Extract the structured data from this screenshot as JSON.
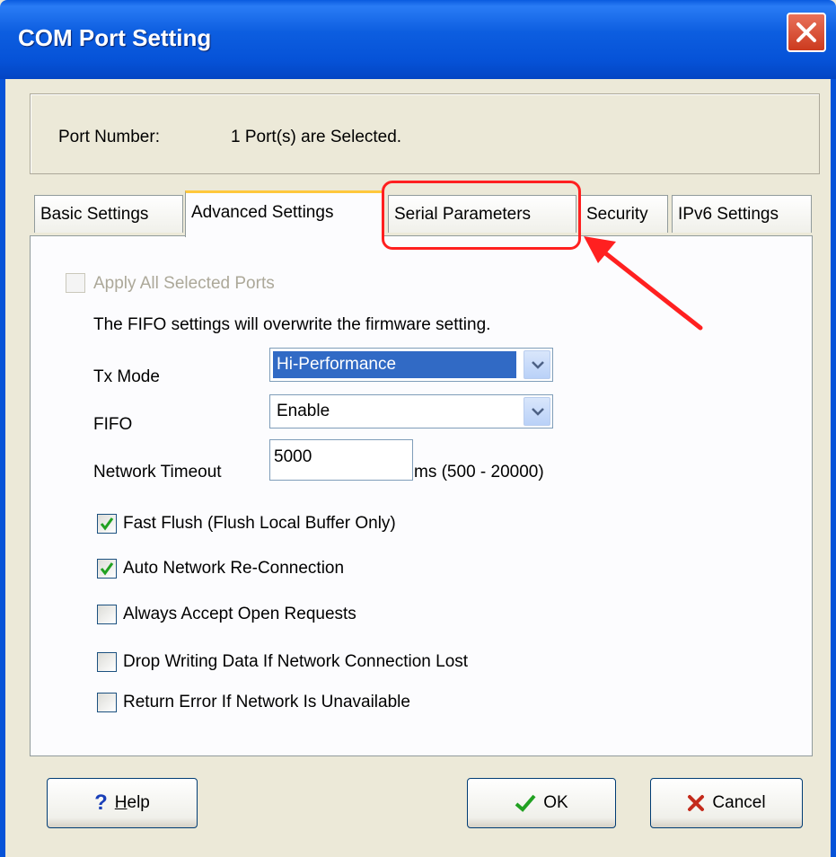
{
  "window": {
    "title": "COM Port Setting"
  },
  "port": {
    "label": "Port Number:",
    "value": "1 Port(s) are Selected."
  },
  "tabs": [
    {
      "label": "Basic Settings"
    },
    {
      "label": "Advanced Settings"
    },
    {
      "label": "Serial Parameters"
    },
    {
      "label": "Security"
    },
    {
      "label": "IPv6 Settings"
    }
  ],
  "advanced": {
    "apply_all": {
      "label": "Apply All Selected Ports",
      "checked": false,
      "enabled": false
    },
    "fifo_note": "The FIFO settings will overwrite the firmware setting.",
    "tx_mode": {
      "label": "Tx Mode",
      "value": "Hi-Performance"
    },
    "fifo": {
      "label": "FIFO",
      "value": "Enable"
    },
    "network_timeout": {
      "label": "Network Timeout",
      "value": "5000",
      "range": "ms (500 - 20000)"
    },
    "options": [
      {
        "label": "Fast Flush (Flush Local Buffer Only)",
        "checked": true
      },
      {
        "label": "Auto Network Re-Connection",
        "checked": true
      },
      {
        "label": "Always Accept Open Requests",
        "checked": false
      },
      {
        "label": "Drop Writing Data If Network Connection Lost",
        "checked": false
      },
      {
        "label": "Return Error If Network Is Unavailable",
        "checked": false
      }
    ]
  },
  "buttons": {
    "help": {
      "label": "Help",
      "mnemonic": "H",
      "rest": "elp"
    },
    "ok": {
      "label": "OK"
    },
    "cancel": {
      "label": "Cancel"
    }
  },
  "colors": {
    "titlebar": "#0653d8",
    "selection": "#316ac5",
    "check": "#21a121",
    "annotation": "#ff2020",
    "active_tab_accent": "#ffc83c"
  }
}
